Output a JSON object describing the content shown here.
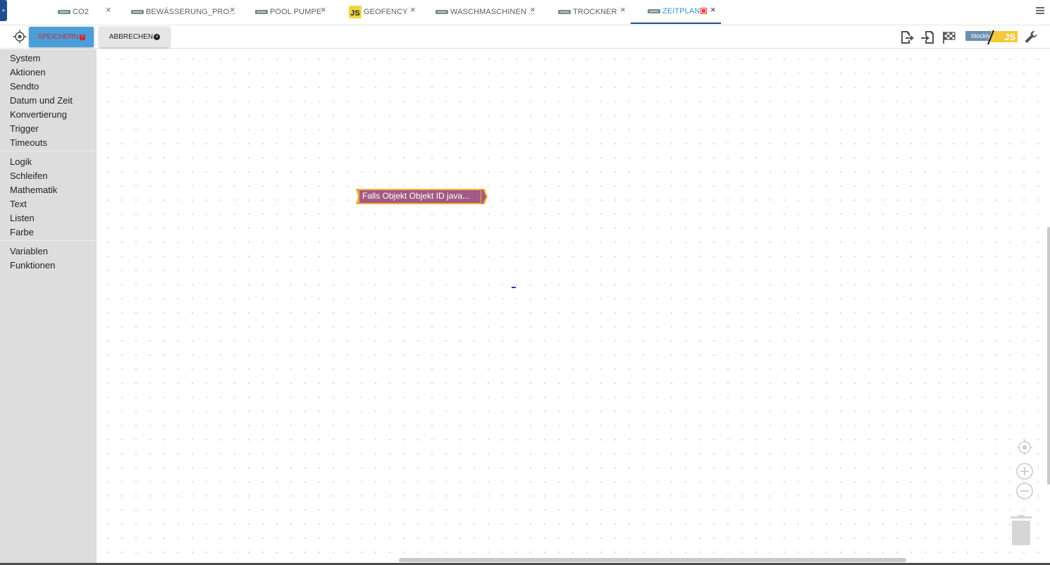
{
  "tabs": [
    {
      "label": "CO2",
      "icon": "blockly-icon"
    },
    {
      "label": "BEWÄSSERUNG_PRO...",
      "icon": "blockly-icon"
    },
    {
      "label": "POOL PUMPE",
      "icon": "blockly-icon"
    },
    {
      "label": "GEOFENCY",
      "icon": "javascript-icon",
      "icon_text": "JS"
    },
    {
      "label": "WASCHMASCHINEN ...",
      "icon": "blockly-icon"
    },
    {
      "label": "TROCKNER",
      "icon": "blockly-icon"
    },
    {
      "label": "ZEITPLAN",
      "icon": "blockly-icon",
      "active": true,
      "status": "stop-icon"
    }
  ],
  "tab_close_symbol": "×",
  "toolbar": {
    "save_label": "SPEICHERN",
    "cancel_label": "ABBRECHEN",
    "blockly_label": "blockly",
    "js_label": "JS",
    "save_color": "#4a9fd8",
    "save_text_color": "#d3273a"
  },
  "toolbox": {
    "groups": [
      [
        "System",
        "Aktionen",
        "Sendto",
        "Datum und Zeit",
        "Konvertierung",
        "Trigger",
        "Timeouts"
      ],
      [
        "Logik",
        "Schleifen",
        "Mathematik",
        "Text",
        "Listen",
        "Farbe"
      ],
      [
        "Variablen",
        "Funktionen"
      ]
    ]
  },
  "workspace": {
    "block_text": "Falls Objekt Objekt ID java...",
    "block_color": "#a25a86",
    "block_border_color": "#f2b233"
  }
}
